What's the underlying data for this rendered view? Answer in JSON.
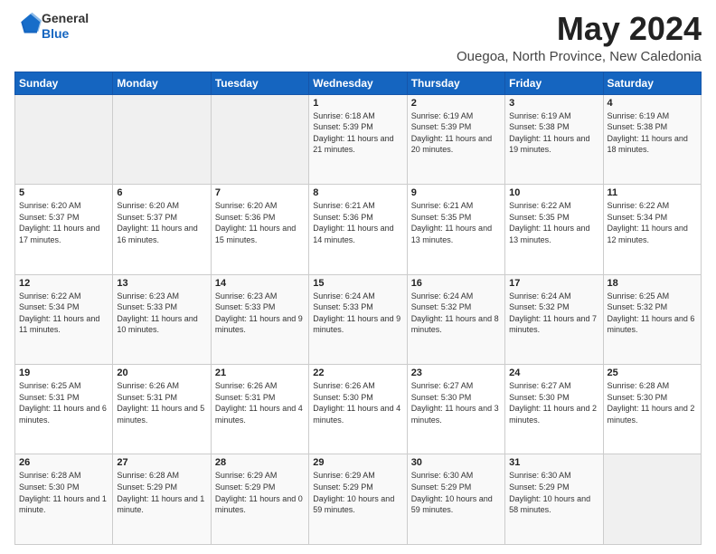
{
  "logo": {
    "general": "General",
    "blue": "Blue"
  },
  "header": {
    "month_year": "May 2024",
    "location": "Ouegoa, North Province, New Caledonia"
  },
  "days_of_week": [
    "Sunday",
    "Monday",
    "Tuesday",
    "Wednesday",
    "Thursday",
    "Friday",
    "Saturday"
  ],
  "weeks": [
    [
      {
        "day": "",
        "info": ""
      },
      {
        "day": "",
        "info": ""
      },
      {
        "day": "",
        "info": ""
      },
      {
        "day": "1",
        "info": "Sunrise: 6:18 AM\nSunset: 5:39 PM\nDaylight: 11 hours and 21 minutes."
      },
      {
        "day": "2",
        "info": "Sunrise: 6:19 AM\nSunset: 5:39 PM\nDaylight: 11 hours and 20 minutes."
      },
      {
        "day": "3",
        "info": "Sunrise: 6:19 AM\nSunset: 5:38 PM\nDaylight: 11 hours and 19 minutes."
      },
      {
        "day": "4",
        "info": "Sunrise: 6:19 AM\nSunset: 5:38 PM\nDaylight: 11 hours and 18 minutes."
      }
    ],
    [
      {
        "day": "5",
        "info": "Sunrise: 6:20 AM\nSunset: 5:37 PM\nDaylight: 11 hours and 17 minutes."
      },
      {
        "day": "6",
        "info": "Sunrise: 6:20 AM\nSunset: 5:37 PM\nDaylight: 11 hours and 16 minutes."
      },
      {
        "day": "7",
        "info": "Sunrise: 6:20 AM\nSunset: 5:36 PM\nDaylight: 11 hours and 15 minutes."
      },
      {
        "day": "8",
        "info": "Sunrise: 6:21 AM\nSunset: 5:36 PM\nDaylight: 11 hours and 14 minutes."
      },
      {
        "day": "9",
        "info": "Sunrise: 6:21 AM\nSunset: 5:35 PM\nDaylight: 11 hours and 13 minutes."
      },
      {
        "day": "10",
        "info": "Sunrise: 6:22 AM\nSunset: 5:35 PM\nDaylight: 11 hours and 13 minutes."
      },
      {
        "day": "11",
        "info": "Sunrise: 6:22 AM\nSunset: 5:34 PM\nDaylight: 11 hours and 12 minutes."
      }
    ],
    [
      {
        "day": "12",
        "info": "Sunrise: 6:22 AM\nSunset: 5:34 PM\nDaylight: 11 hours and 11 minutes."
      },
      {
        "day": "13",
        "info": "Sunrise: 6:23 AM\nSunset: 5:33 PM\nDaylight: 11 hours and 10 minutes."
      },
      {
        "day": "14",
        "info": "Sunrise: 6:23 AM\nSunset: 5:33 PM\nDaylight: 11 hours and 9 minutes."
      },
      {
        "day": "15",
        "info": "Sunrise: 6:24 AM\nSunset: 5:33 PM\nDaylight: 11 hours and 9 minutes."
      },
      {
        "day": "16",
        "info": "Sunrise: 6:24 AM\nSunset: 5:32 PM\nDaylight: 11 hours and 8 minutes."
      },
      {
        "day": "17",
        "info": "Sunrise: 6:24 AM\nSunset: 5:32 PM\nDaylight: 11 hours and 7 minutes."
      },
      {
        "day": "18",
        "info": "Sunrise: 6:25 AM\nSunset: 5:32 PM\nDaylight: 11 hours and 6 minutes."
      }
    ],
    [
      {
        "day": "19",
        "info": "Sunrise: 6:25 AM\nSunset: 5:31 PM\nDaylight: 11 hours and 6 minutes."
      },
      {
        "day": "20",
        "info": "Sunrise: 6:26 AM\nSunset: 5:31 PM\nDaylight: 11 hours and 5 minutes."
      },
      {
        "day": "21",
        "info": "Sunrise: 6:26 AM\nSunset: 5:31 PM\nDaylight: 11 hours and 4 minutes."
      },
      {
        "day": "22",
        "info": "Sunrise: 6:26 AM\nSunset: 5:30 PM\nDaylight: 11 hours and 4 minutes."
      },
      {
        "day": "23",
        "info": "Sunrise: 6:27 AM\nSunset: 5:30 PM\nDaylight: 11 hours and 3 minutes."
      },
      {
        "day": "24",
        "info": "Sunrise: 6:27 AM\nSunset: 5:30 PM\nDaylight: 11 hours and 2 minutes."
      },
      {
        "day": "25",
        "info": "Sunrise: 6:28 AM\nSunset: 5:30 PM\nDaylight: 11 hours and 2 minutes."
      }
    ],
    [
      {
        "day": "26",
        "info": "Sunrise: 6:28 AM\nSunset: 5:30 PM\nDaylight: 11 hours and 1 minute."
      },
      {
        "day": "27",
        "info": "Sunrise: 6:28 AM\nSunset: 5:29 PM\nDaylight: 11 hours and 1 minute."
      },
      {
        "day": "28",
        "info": "Sunrise: 6:29 AM\nSunset: 5:29 PM\nDaylight: 11 hours and 0 minutes."
      },
      {
        "day": "29",
        "info": "Sunrise: 6:29 AM\nSunset: 5:29 PM\nDaylight: 10 hours and 59 minutes."
      },
      {
        "day": "30",
        "info": "Sunrise: 6:30 AM\nSunset: 5:29 PM\nDaylight: 10 hours and 59 minutes."
      },
      {
        "day": "31",
        "info": "Sunrise: 6:30 AM\nSunset: 5:29 PM\nDaylight: 10 hours and 58 minutes."
      },
      {
        "day": "",
        "info": ""
      }
    ]
  ]
}
